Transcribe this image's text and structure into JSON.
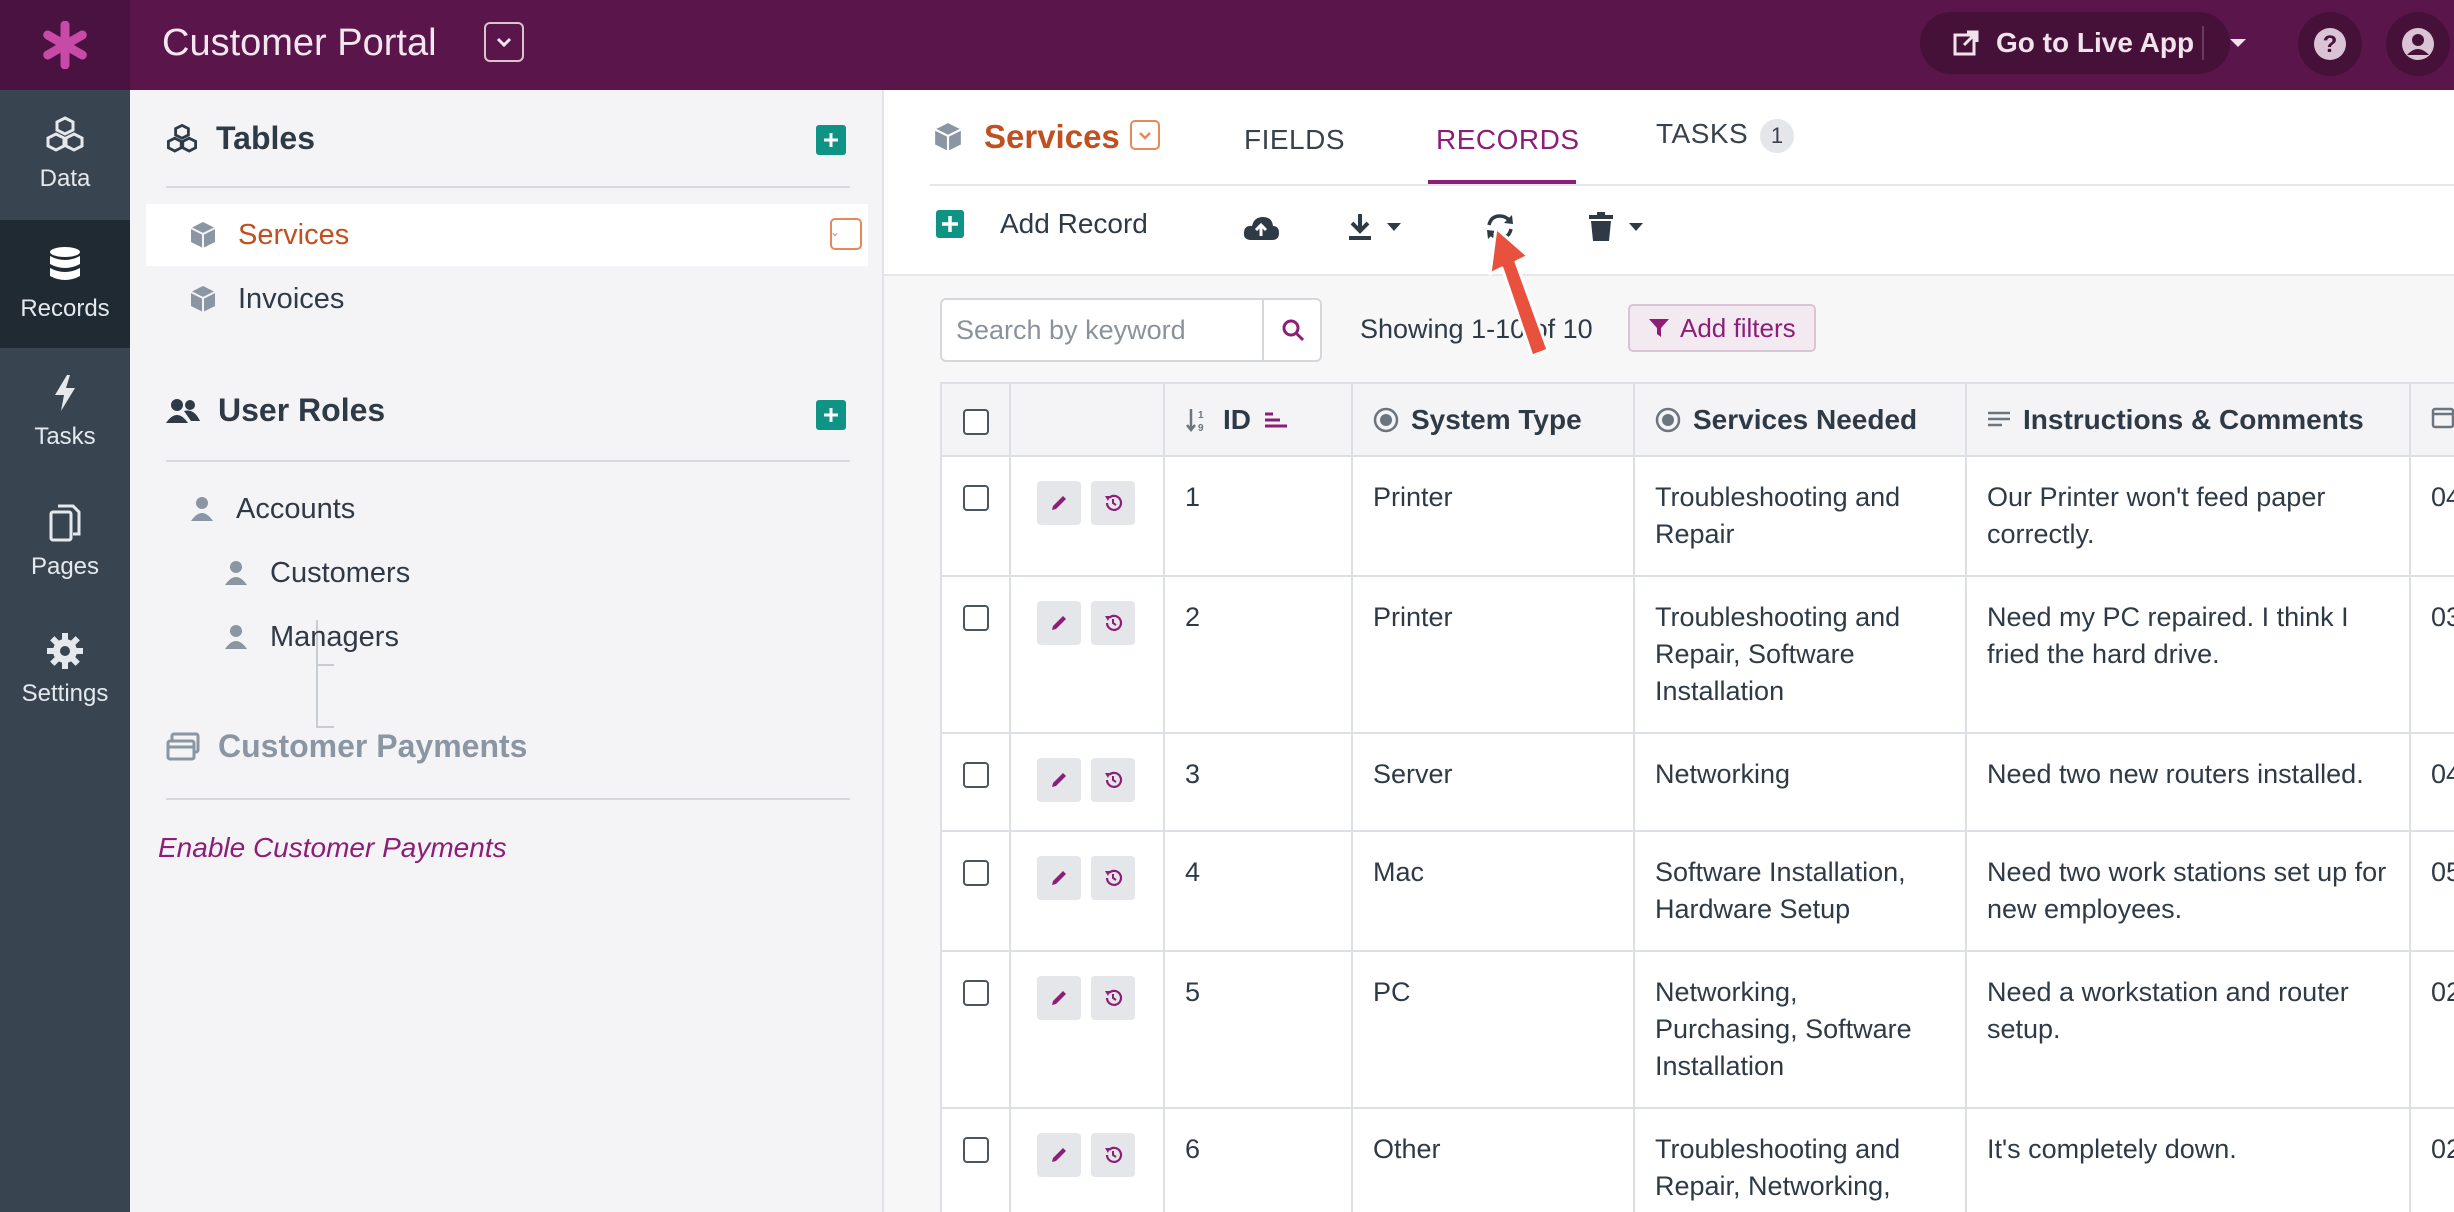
{
  "app": {
    "title": "Customer Portal",
    "live_button": "Go to Live App"
  },
  "colors": {
    "brand": "#5a154b",
    "accent": "#8d1e78",
    "active_table": "#c0501f",
    "add_green": "#0e9384"
  },
  "leftnav": [
    {
      "label": "Data",
      "icon": "data-cubes-icon"
    },
    {
      "label": "Records",
      "icon": "database-icon",
      "active": true
    },
    {
      "label": "Tasks",
      "icon": "lightning-icon"
    },
    {
      "label": "Pages",
      "icon": "pages-icon"
    },
    {
      "label": "Settings",
      "icon": "gear-icon"
    }
  ],
  "sidebar": {
    "tables_heading": "Tables",
    "tables": [
      "Services",
      "Invoices"
    ],
    "roles_heading": "User Roles",
    "roles": {
      "accounts": "Accounts",
      "customers": "Customers",
      "managers": "Managers"
    },
    "payments_heading": "Customer Payments",
    "payments_link": "Enable Customer Payments"
  },
  "main": {
    "object_title": "Services",
    "tabs": {
      "fields": "FIELDS",
      "records": "RECORDS",
      "tasks": "TASKS",
      "tasks_count": "1"
    },
    "toolbar": {
      "add_record": "Add Record"
    },
    "search_placeholder": "Search by keyword",
    "showing": "Showing 1-10 of 10",
    "add_filters": "Add filters"
  },
  "table": {
    "columns": {
      "id": "ID",
      "system_type": "System Type",
      "services_needed": "Services Needed",
      "instructions": "Instructions & Comments"
    },
    "rows": [
      {
        "id": "1",
        "system_type": "Printer",
        "services_needed": "Troubleshooting and Repair",
        "instructions": "Our Printer won't feed paper correctly.",
        "next_col": "04"
      },
      {
        "id": "2",
        "system_type": "Printer",
        "services_needed": "Troubleshooting and Repair, Software Installation",
        "instructions": "Need my PC repaired. I think I fried the hard drive.",
        "next_col": "03"
      },
      {
        "id": "3",
        "system_type": "Server",
        "services_needed": "Networking",
        "instructions": "Need two new routers installed.",
        "next_col": "04"
      },
      {
        "id": "4",
        "system_type": "Mac",
        "services_needed": "Software Installation, Hardware Setup",
        "instructions": "Need two work stations set up for new employees.",
        "next_col": "05"
      },
      {
        "id": "5",
        "system_type": "PC",
        "services_needed": "Networking, Purchasing, Software Installation",
        "instructions": "Need a workstation and router setup.",
        "next_col": "02"
      },
      {
        "id": "6",
        "system_type": "Other",
        "services_needed": "Troubleshooting and Repair, Networking, Purchasing, Software",
        "instructions": "It's completely down.",
        "next_col": "02"
      }
    ]
  }
}
